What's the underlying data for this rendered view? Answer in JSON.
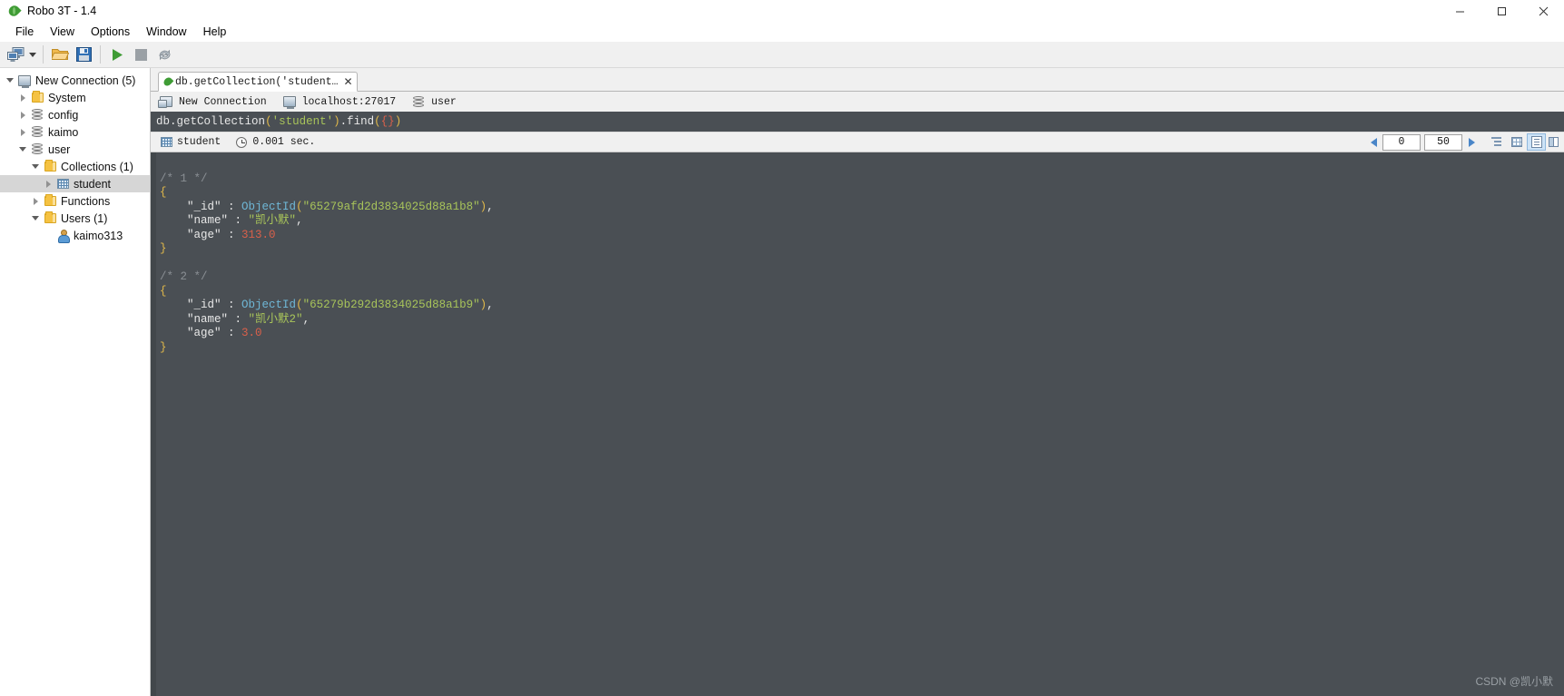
{
  "window": {
    "title": "Robo 3T - 1.4",
    "app_icon": "leaf-icon",
    "minimize": "minimize-icon",
    "maximize": "maximize-icon",
    "close": "close-icon"
  },
  "menubar": {
    "items": [
      {
        "label": "File"
      },
      {
        "label": "View"
      },
      {
        "label": "Options"
      },
      {
        "label": "Window"
      },
      {
        "label": "Help"
      }
    ]
  },
  "toolbar": {
    "buttons": [
      {
        "name": "connect-button",
        "icon": "computers-icon"
      },
      {
        "name": "connect-dropdown",
        "icon": "chevron-down-icon"
      },
      {
        "name": "open-script-button",
        "icon": "folder-open-icon"
      },
      {
        "name": "save-script-button",
        "icon": "floppy-disk-icon"
      },
      {
        "name": "execute-button",
        "icon": "play-icon"
      },
      {
        "name": "stop-button",
        "icon": "stop-icon"
      },
      {
        "name": "refresh-button",
        "icon": "rotate-icon"
      }
    ]
  },
  "sidebar": {
    "tree": [
      {
        "label": "New Connection (5)",
        "icon": "monitor-icon",
        "twisty": "down",
        "indent": 0,
        "selected": false
      },
      {
        "label": "System",
        "icon": "folder-icon",
        "twisty": "right",
        "indent": 1,
        "selected": false
      },
      {
        "label": "config",
        "icon": "database-icon",
        "twisty": "right",
        "indent": 1,
        "selected": false
      },
      {
        "label": "kaimo",
        "icon": "database-icon",
        "twisty": "right",
        "indent": 1,
        "selected": false
      },
      {
        "label": "user",
        "icon": "database-icon",
        "twisty": "down",
        "indent": 1,
        "selected": false
      },
      {
        "label": "Collections (1)",
        "icon": "folder-icon",
        "twisty": "down",
        "indent": 2,
        "selected": false
      },
      {
        "label": "student",
        "icon": "collection-icon",
        "twisty": "right",
        "indent": 3,
        "selected": true
      },
      {
        "label": "Functions",
        "icon": "folder-icon",
        "twisty": "right",
        "indent": 2,
        "selected": false
      },
      {
        "label": "Users (1)",
        "icon": "folder-icon",
        "twisty": "down",
        "indent": 2,
        "selected": false
      },
      {
        "label": "kaimo313",
        "icon": "user-icon",
        "twisty": "none",
        "indent": 3,
        "selected": false
      }
    ]
  },
  "tabs": [
    {
      "label": "db.getCollection('student…",
      "icon": "leaf-icon",
      "close": "✕",
      "active": true
    }
  ],
  "connection_info": {
    "connection": {
      "label": "New Connection",
      "icon": "server-icon"
    },
    "host": {
      "label": "localhost:27017",
      "icon": "monitor-icon"
    },
    "database": {
      "label": "user",
      "icon": "database-icon"
    }
  },
  "editor": {
    "query_tokens": [
      {
        "text": "db",
        "color": "white"
      },
      {
        "text": ".",
        "color": "white"
      },
      {
        "text": "getCollection",
        "color": "white"
      },
      {
        "text": "(",
        "color": "yellow"
      },
      {
        "text": "'student'",
        "color": "green"
      },
      {
        "text": ")",
        "color": "yellow"
      },
      {
        "text": ".",
        "color": "white"
      },
      {
        "text": "find",
        "color": "white"
      },
      {
        "text": "(",
        "color": "yellow"
      },
      {
        "text": "{",
        "color": "red"
      },
      {
        "text": "}",
        "color": "red"
      },
      {
        "text": ")",
        "color": "yellow"
      }
    ],
    "query_plain": "db.getCollection('student').find({})"
  },
  "results_toolbar": {
    "collection_label": "student",
    "collection_icon": "collection-icon",
    "time_label": "0.001 sec.",
    "time_icon": "clock-icon",
    "prev_icon": "left-arrow-icon",
    "next_icon": "right-arrow-icon",
    "skip_value": "0",
    "limit_value": "50",
    "view_buttons": [
      {
        "name": "tree-view-button",
        "icon": "tree-view-icon",
        "active": false
      },
      {
        "name": "table-view-button",
        "icon": "table-view-icon",
        "active": false
      },
      {
        "name": "text-view-button",
        "icon": "document-view-icon",
        "active": true
      },
      {
        "name": "split-panel-button",
        "icon": "panel-icon",
        "active": false
      }
    ]
  },
  "results": {
    "documents": [
      {
        "comment": "/* 1 */",
        "fields": [
          {
            "key": "\"_id\"",
            "fn": "ObjectId",
            "value": "\"65279afd2d3834025d88a1b8\"",
            "type": "objectid",
            "trailing": ","
          },
          {
            "key": "\"name\"",
            "value": "\"凯小默\"",
            "type": "string",
            "trailing": ","
          },
          {
            "key": "\"age\"",
            "value": "313.0",
            "type": "number",
            "trailing": ""
          }
        ]
      },
      {
        "comment": "/* 2 */",
        "fields": [
          {
            "key": "\"_id\"",
            "fn": "ObjectId",
            "value": "\"65279b292d3834025d88a1b9\"",
            "type": "objectid",
            "trailing": ","
          },
          {
            "key": "\"name\"",
            "value": "\"凯小默2\"",
            "type": "string",
            "trailing": ","
          },
          {
            "key": "\"age\"",
            "value": "3.0",
            "type": "number",
            "trailing": ""
          }
        ]
      }
    ],
    "watermark": "CSDN @凯小默"
  },
  "colors": {
    "editor_bg": "#4a4f54",
    "accent_blue": "#4a86c8",
    "string_green": "#a8c45a",
    "number_red": "#d9604a",
    "brace_yellow": "#e0b84a",
    "fn_blue": "#6fb7d6",
    "comment_gray": "#8a8f94",
    "selection_gray": "#d6d6d6"
  }
}
